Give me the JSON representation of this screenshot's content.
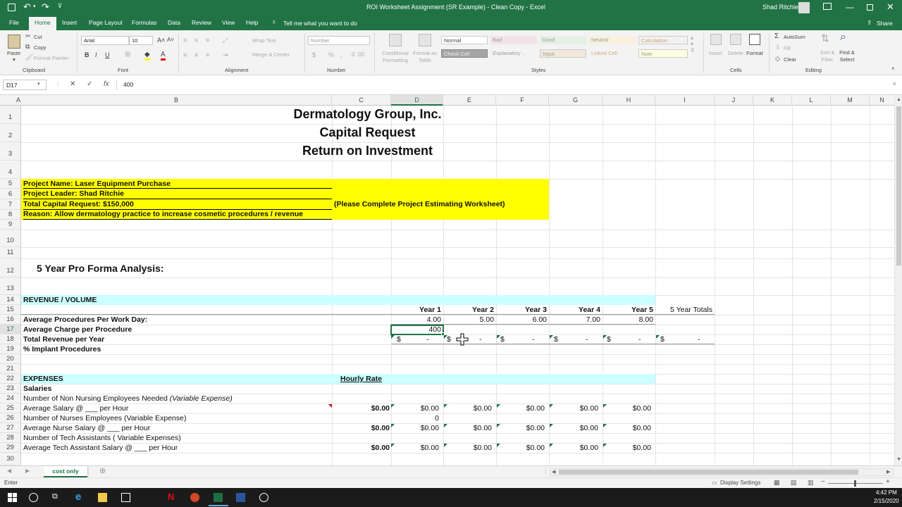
{
  "titlebar": {
    "title": "ROI Worksheet Assignment (SR Example) - Clean Copy  -  Excel",
    "user": "Shad Ritchie"
  },
  "tabs": [
    "File",
    "Home",
    "Insert",
    "Page Layout",
    "Formulas",
    "Data",
    "Review",
    "View",
    "Help"
  ],
  "tell_me": "Tell me what you want to do",
  "share": "Share",
  "ribbon": {
    "paste": "Paste",
    "cut": "Cut",
    "copy": "Copy",
    "format_painter": "Format Painter",
    "clipboard": "Clipboard",
    "font_name": "Arial",
    "font_size": "10",
    "font": "Font",
    "wrap_text": "Wrap Text",
    "merge_center": "Merge & Center",
    "alignment": "Alignment",
    "number_format": "Number",
    "number": "Number",
    "conditional_formatting": "Conditional Formatting",
    "format_as_table": "Format as Table",
    "style_names": [
      "Normal",
      "Bad",
      "Good",
      "Neutral",
      "Calculation",
      "Check Cell",
      "Explanatory ...",
      "Input",
      "Linked Cell",
      "Note"
    ],
    "styles": "Styles",
    "insert": "Insert",
    "delete": "Delete",
    "format": "Format",
    "cells": "Cells",
    "autosum": "AutoSum",
    "fill": "Fill",
    "clear": "Clear",
    "sort_filter": "Sort & Filter",
    "find_select": "Find & Select",
    "editing": "Editing"
  },
  "formula_bar": {
    "name_box": "D17",
    "value": "400"
  },
  "columns": [
    "A",
    "B",
    "C",
    "D",
    "E",
    "F",
    "G",
    "H",
    "I",
    "J",
    "K",
    "L",
    "M",
    "N"
  ],
  "rows": [
    "1",
    "2",
    "3",
    "4",
    "5",
    "6",
    "7",
    "8",
    "9",
    "10",
    "11",
    "12",
    "13",
    "14",
    "15",
    "16",
    "17",
    "18",
    "19",
    "20",
    "21",
    "22",
    "23",
    "24",
    "25",
    "26",
    "27",
    "28",
    "29",
    "30"
  ],
  "sheet": {
    "title1": "Dermatology Group, Inc.",
    "title2": "Capital Request",
    "title3": "Return on Investment",
    "project_name": "Project Name:   Laser Equipment Purchase",
    "project_leader": "Project Leader:   Shad Ritchie",
    "capital_request": "Total Capital Request:   $150,000",
    "reason": "Reason:   Allow dermatology practice to increase cosmetic procedures / revenue",
    "note": "(Please Complete Project Estimating Worksheet)",
    "pro_forma": "5 Year Pro Forma Analysis:",
    "revenue_volume": "REVENUE / VOLUME",
    "years": [
      "Year 1",
      "Year 2",
      "Year 3",
      "Year 4",
      "Year 5"
    ],
    "five_year_totals": "5 Year Totals",
    "avg_procedures_label": "Average Procedures Per Work Day:",
    "avg_procedures": [
      "4.00",
      "5.00",
      "6.00",
      "7.00",
      "8.00"
    ],
    "avg_charge_label": "Average Charge per Procedure",
    "avg_charge": "400",
    "total_revenue_label": "Total Revenue per Year",
    "dollar": "$",
    "dash": "-",
    "implant_label": "% Implant Procedures",
    "expenses": "EXPENSES",
    "hourly_rate": "Hourly Rate",
    "salaries": "Salaries",
    "r24a": "Number of Non Nursing Employees Needed ",
    "r24b": "(Variable Expense)",
    "r25": "Average Salary @ ___ per Hour",
    "r26": "Number of Nurses Employees (Variable Expense)",
    "r26_value": "0",
    "r27": "Average Nurse Salary @ ___ per Hour",
    "r28": "Number of Tech Assistants ( Variable Expenses)",
    "r29": "Average Tech Assistant Salary @ ___ per Hour",
    "zero": "$0.00"
  },
  "sheet_tab": "cost only",
  "status": {
    "mode": "Enter",
    "display_settings": "Display Settings"
  },
  "clock": {
    "time": "4:42 PM",
    "date": "2/15/2020"
  }
}
